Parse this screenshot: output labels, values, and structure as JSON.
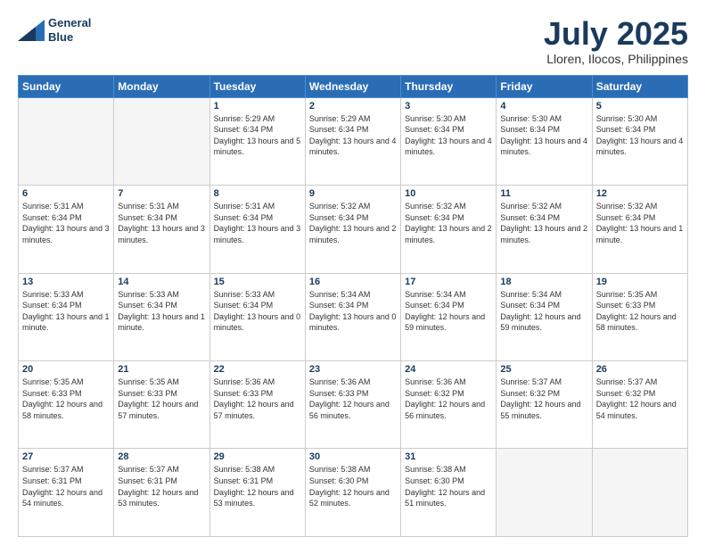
{
  "header": {
    "logo_line1": "General",
    "logo_line2": "Blue",
    "title": "July 2025",
    "subtitle": "Lloren, Ilocos, Philippines"
  },
  "weekdays": [
    "Sunday",
    "Monday",
    "Tuesday",
    "Wednesday",
    "Thursday",
    "Friday",
    "Saturday"
  ],
  "weeks": [
    [
      {
        "day": "",
        "info": ""
      },
      {
        "day": "",
        "info": ""
      },
      {
        "day": "1",
        "info": "Sunrise: 5:29 AM\nSunset: 6:34 PM\nDaylight: 13 hours and 5 minutes."
      },
      {
        "day": "2",
        "info": "Sunrise: 5:29 AM\nSunset: 6:34 PM\nDaylight: 13 hours and 4 minutes."
      },
      {
        "day": "3",
        "info": "Sunrise: 5:30 AM\nSunset: 6:34 PM\nDaylight: 13 hours and 4 minutes."
      },
      {
        "day": "4",
        "info": "Sunrise: 5:30 AM\nSunset: 6:34 PM\nDaylight: 13 hours and 4 minutes."
      },
      {
        "day": "5",
        "info": "Sunrise: 5:30 AM\nSunset: 6:34 PM\nDaylight: 13 hours and 4 minutes."
      }
    ],
    [
      {
        "day": "6",
        "info": "Sunrise: 5:31 AM\nSunset: 6:34 PM\nDaylight: 13 hours and 3 minutes."
      },
      {
        "day": "7",
        "info": "Sunrise: 5:31 AM\nSunset: 6:34 PM\nDaylight: 13 hours and 3 minutes."
      },
      {
        "day": "8",
        "info": "Sunrise: 5:31 AM\nSunset: 6:34 PM\nDaylight: 13 hours and 3 minutes."
      },
      {
        "day": "9",
        "info": "Sunrise: 5:32 AM\nSunset: 6:34 PM\nDaylight: 13 hours and 2 minutes."
      },
      {
        "day": "10",
        "info": "Sunrise: 5:32 AM\nSunset: 6:34 PM\nDaylight: 13 hours and 2 minutes."
      },
      {
        "day": "11",
        "info": "Sunrise: 5:32 AM\nSunset: 6:34 PM\nDaylight: 13 hours and 2 minutes."
      },
      {
        "day": "12",
        "info": "Sunrise: 5:32 AM\nSunset: 6:34 PM\nDaylight: 13 hours and 1 minute."
      }
    ],
    [
      {
        "day": "13",
        "info": "Sunrise: 5:33 AM\nSunset: 6:34 PM\nDaylight: 13 hours and 1 minute."
      },
      {
        "day": "14",
        "info": "Sunrise: 5:33 AM\nSunset: 6:34 PM\nDaylight: 13 hours and 1 minute."
      },
      {
        "day": "15",
        "info": "Sunrise: 5:33 AM\nSunset: 6:34 PM\nDaylight: 13 hours and 0 minutes."
      },
      {
        "day": "16",
        "info": "Sunrise: 5:34 AM\nSunset: 6:34 PM\nDaylight: 13 hours and 0 minutes."
      },
      {
        "day": "17",
        "info": "Sunrise: 5:34 AM\nSunset: 6:34 PM\nDaylight: 12 hours and 59 minutes."
      },
      {
        "day": "18",
        "info": "Sunrise: 5:34 AM\nSunset: 6:34 PM\nDaylight: 12 hours and 59 minutes."
      },
      {
        "day": "19",
        "info": "Sunrise: 5:35 AM\nSunset: 6:33 PM\nDaylight: 12 hours and 58 minutes."
      }
    ],
    [
      {
        "day": "20",
        "info": "Sunrise: 5:35 AM\nSunset: 6:33 PM\nDaylight: 12 hours and 58 minutes."
      },
      {
        "day": "21",
        "info": "Sunrise: 5:35 AM\nSunset: 6:33 PM\nDaylight: 12 hours and 57 minutes."
      },
      {
        "day": "22",
        "info": "Sunrise: 5:36 AM\nSunset: 6:33 PM\nDaylight: 12 hours and 57 minutes."
      },
      {
        "day": "23",
        "info": "Sunrise: 5:36 AM\nSunset: 6:33 PM\nDaylight: 12 hours and 56 minutes."
      },
      {
        "day": "24",
        "info": "Sunrise: 5:36 AM\nSunset: 6:32 PM\nDaylight: 12 hours and 56 minutes."
      },
      {
        "day": "25",
        "info": "Sunrise: 5:37 AM\nSunset: 6:32 PM\nDaylight: 12 hours and 55 minutes."
      },
      {
        "day": "26",
        "info": "Sunrise: 5:37 AM\nSunset: 6:32 PM\nDaylight: 12 hours and 54 minutes."
      }
    ],
    [
      {
        "day": "27",
        "info": "Sunrise: 5:37 AM\nSunset: 6:31 PM\nDaylight: 12 hours and 54 minutes."
      },
      {
        "day": "28",
        "info": "Sunrise: 5:37 AM\nSunset: 6:31 PM\nDaylight: 12 hours and 53 minutes."
      },
      {
        "day": "29",
        "info": "Sunrise: 5:38 AM\nSunset: 6:31 PM\nDaylight: 12 hours and 53 minutes."
      },
      {
        "day": "30",
        "info": "Sunrise: 5:38 AM\nSunset: 6:30 PM\nDaylight: 12 hours and 52 minutes."
      },
      {
        "day": "31",
        "info": "Sunrise: 5:38 AM\nSunset: 6:30 PM\nDaylight: 12 hours and 51 minutes."
      },
      {
        "day": "",
        "info": ""
      },
      {
        "day": "",
        "info": ""
      }
    ]
  ]
}
